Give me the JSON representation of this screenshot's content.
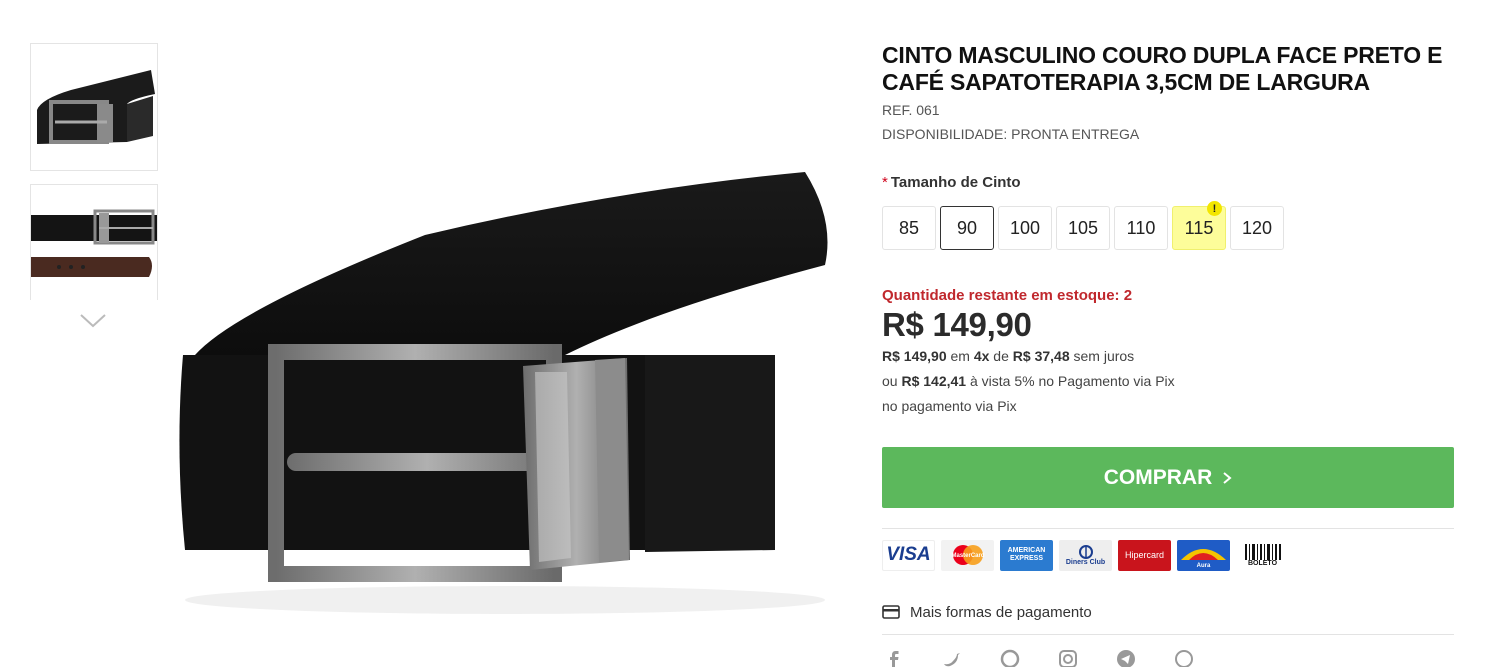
{
  "product": {
    "title": "CINTO MASCULINO COURO DUPLA FACE PRETO E CAFÉ SAPATOTERAPIA 3,5CM DE LARGURA",
    "ref": "REF. 061",
    "availability": "DISPONIBILIDADE: PRONTA ENTREGA"
  },
  "size_selector": {
    "required_mark": "*",
    "label": "Tamanho de Cinto",
    "options": [
      "85",
      "90",
      "100",
      "105",
      "110",
      "115",
      "120"
    ],
    "selected": "90",
    "low_stock_option": "115",
    "low_stock_badge": "!"
  },
  "pricing": {
    "stock_notice": "Quantidade restante em estoque: 2",
    "price": "R$ 149,90",
    "installment": {
      "amount": "R$ 149,90",
      "text1": " em ",
      "count": "4x",
      "text2": " de ",
      "per": "R$ 37,48",
      "text3": " sem juros"
    },
    "pix": {
      "prefix": "ou ",
      "amount": "R$ 142,41",
      "suffix": " à vista 5% no Pagamento via Pix"
    },
    "pix_note": "no pagamento via Pix"
  },
  "buy_button": {
    "label": "COMPRAR",
    "icon": "chevron-right-icon"
  },
  "payment_methods": {
    "visa": "VISA",
    "mastercard": "MasterCard",
    "amex": "AMERICAN EXPRESS",
    "diners": "Diners Club",
    "hipercard": "Hipercard",
    "aura": "Aura",
    "boleto": "BOLETO"
  },
  "more_payment": {
    "label": "Mais formas de pagamento",
    "icon": "credit-card-icon"
  },
  "social_icons": [
    "facebook-icon",
    "twitter-icon",
    "pinterest-icon",
    "instagram-icon",
    "telegram-icon",
    "whatsapp-icon"
  ],
  "colors": {
    "buy": "#5cb85c",
    "stock": "#c0282d",
    "low_stock": "#fdfd9a"
  }
}
